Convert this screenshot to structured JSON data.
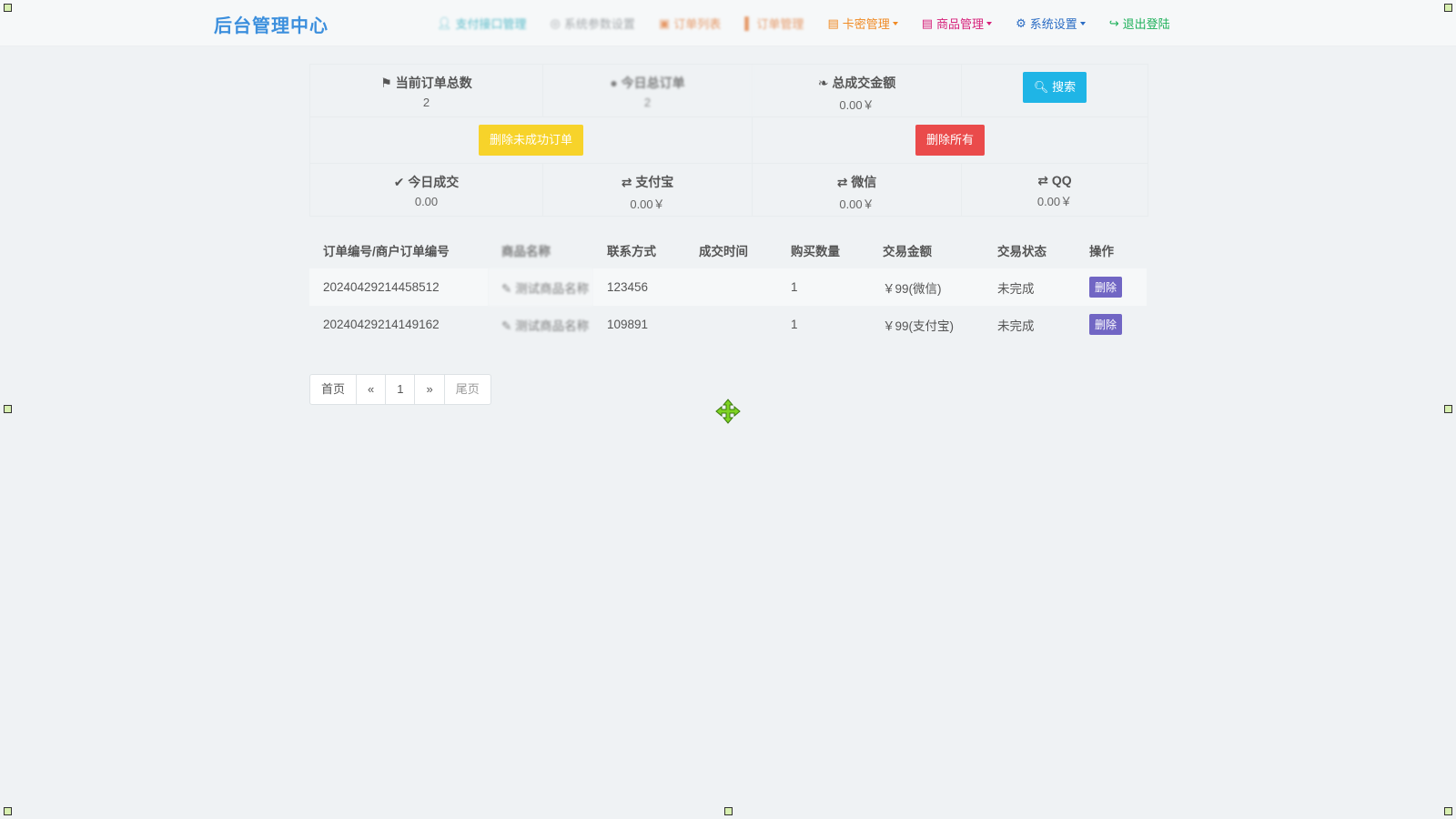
{
  "brand": "后台管理中心",
  "nav": [
    {
      "label": "支付接口管理",
      "icon": "user-icon",
      "color": "#23a6b8",
      "caret": false,
      "blur": true
    },
    {
      "label": "系统参数设置",
      "icon": "settings-circle-icon",
      "color": "#8a8f93",
      "caret": false,
      "blur": true
    },
    {
      "label": "订单列表",
      "icon": "list-icon",
      "color": "#e07a38",
      "caret": false,
      "blur": true
    },
    {
      "label": "订单管理",
      "icon": "book-icon",
      "color": "#e07a38",
      "caret": false,
      "blur": true
    },
    {
      "label": "卡密管理",
      "icon": "card-icon",
      "color": "#f08a24",
      "caret": true,
      "blur": false
    },
    {
      "label": "商品管理",
      "icon": "goods-icon",
      "color": "#d6217a",
      "caret": true,
      "blur": false
    },
    {
      "label": "系统设置",
      "icon": "gear-icon",
      "color": "#2a6cc4",
      "caret": true,
      "blur": false
    },
    {
      "label": "退出登陆",
      "icon": "logout-icon",
      "color": "#1fb15b",
      "caret": false,
      "blur": false
    }
  ],
  "stats": {
    "total_orders_label": "当前订单总数",
    "total_orders_value": "2",
    "today_orders_label": "今日总订单",
    "today_orders_value": "2",
    "total_amount_label": "总成交金额",
    "total_amount_value": "0.00￥",
    "search_label": "搜索",
    "delete_unpaid_label": "删除未成功订单",
    "delete_all_label": "删除所有",
    "today_deal_label": "今日成交",
    "today_deal_value": "0.00",
    "alipay_label": "支付宝",
    "alipay_value": "0.00￥",
    "wechat_label": "微信",
    "wechat_value": "0.00￥",
    "qq_label": "QQ",
    "qq_value": "0.00￥"
  },
  "table": {
    "headers": [
      "订单编号/商户订单编号",
      "商品名称",
      "联系方式",
      "成交时间",
      "购买数量",
      "交易金额",
      "交易状态",
      "操作"
    ],
    "rows": [
      {
        "order_no": "20240429214458512",
        "product": "测试商品名称",
        "contact": "123456",
        "time": "",
        "qty": "1",
        "amount": "￥99(微信)",
        "status": "未完成",
        "action": "删除"
      },
      {
        "order_no": "20240429214149162",
        "product": "测试商品名称",
        "contact": "109891",
        "time": "",
        "qty": "1",
        "amount": "￥99(支付宝)",
        "status": "未完成",
        "action": "删除"
      }
    ]
  },
  "pager": [
    "首页",
    "«",
    "1",
    "»",
    "尾页"
  ]
}
